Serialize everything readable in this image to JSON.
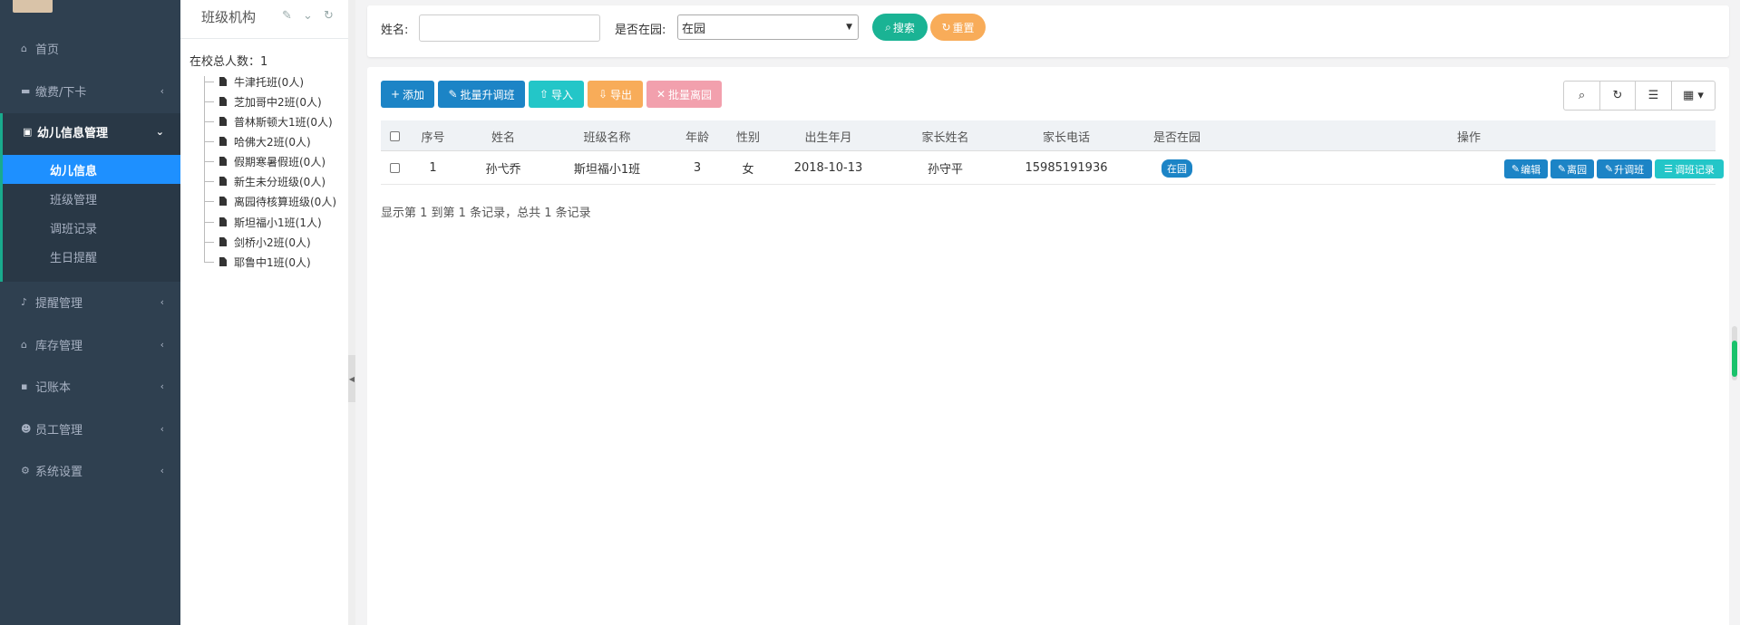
{
  "sidebar": {
    "items": [
      {
        "label": "首页",
        "icon": "home-icon"
      },
      {
        "label": "缴费/下卡",
        "icon": "card-icon"
      },
      {
        "label": "幼儿信息管理",
        "icon": "id-card-icon"
      },
      {
        "label": "提醒管理",
        "icon": "bell-icon"
      },
      {
        "label": "库存管理",
        "icon": "bank-icon"
      },
      {
        "label": "记账本",
        "icon": "folder-icon"
      },
      {
        "label": "员工管理",
        "icon": "users-icon"
      },
      {
        "label": "系统设置",
        "icon": "cogs-icon"
      }
    ],
    "subitems": [
      "幼儿信息",
      "班级管理",
      "调班记录",
      "生日提醒"
    ],
    "chevron": "‹",
    "open_chevron": "⌄"
  },
  "tree": {
    "title": "班级机构",
    "total": "在校总人数：1",
    "nodes": [
      "牛津托班(0人)",
      "芝加哥中2班(0人)",
      "普林斯顿大1班(0人)",
      "哈佛大2班(0人)",
      "假期寒暑假班(0人)",
      "新生未分班级(0人)",
      "离园待核算班级(0人)",
      "斯坦福小1班(1人)",
      "剑桥小2班(0人)",
      "耶鲁中1班(0人)"
    ]
  },
  "search": {
    "name_label": "姓名:",
    "name_value": "",
    "status_label": "是否在园:",
    "status_value": "在园",
    "search_btn": "搜索",
    "reset_btn": "重置"
  },
  "toolbar": {
    "add": "添加",
    "batch_transfer": "批量升调班",
    "import": "导入",
    "export": "导出",
    "batch_leave": "批量离园"
  },
  "table": {
    "headers": [
      "序号",
      "姓名",
      "班级名称",
      "年龄",
      "性别",
      "出生年月",
      "家长姓名",
      "家长电话",
      "是否在园",
      "操作"
    ],
    "rows": [
      {
        "index": "1",
        "name": "孙弋乔",
        "class": "斯坦福小1班",
        "age": "3",
        "gender": "女",
        "birth": "2018-10-13",
        "parent": "孙守平",
        "phone": "15985191936",
        "status": "在园",
        "ops": [
          "编辑",
          "离园",
          "升调班",
          "调班记录"
        ]
      }
    ]
  },
  "pagination": {
    "info": "显示第 1 到第 1 条记录，总共 1 条记录"
  },
  "colors": {
    "sidebar": "#2f4050",
    "active": "#1e90ff",
    "primary": "#1c84c6",
    "success": "#1ab394",
    "warning": "#f8ac59",
    "info": "#23c6c8",
    "danger": "#f2a0ad"
  }
}
